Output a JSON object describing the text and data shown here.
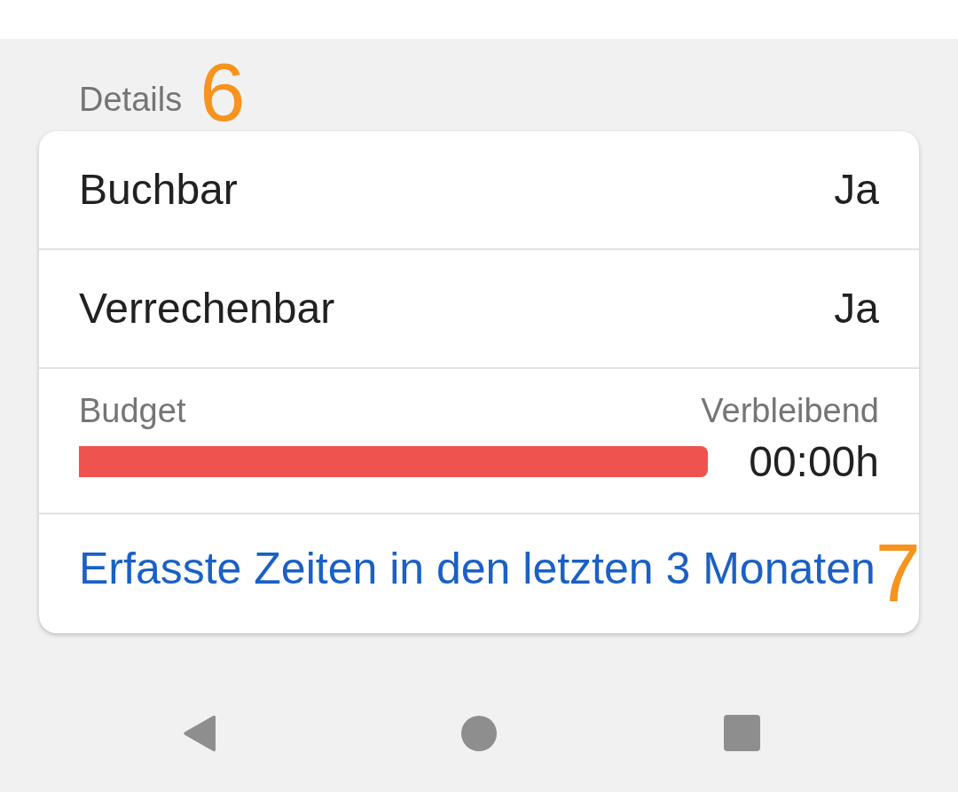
{
  "section": {
    "title": "Details",
    "marker": "6"
  },
  "rows": [
    {
      "label": "Buchbar",
      "value": "Ja"
    },
    {
      "label": "Verrechenbar",
      "value": "Ja"
    }
  ],
  "budget": {
    "label": "Budget",
    "remaining_label": "Verbleibend",
    "level": 1,
    "remaining": "00:00h"
  },
  "link": {
    "text": "Erfasste Zeiten in den letzten 3 Monaten",
    "marker": "7"
  }
}
